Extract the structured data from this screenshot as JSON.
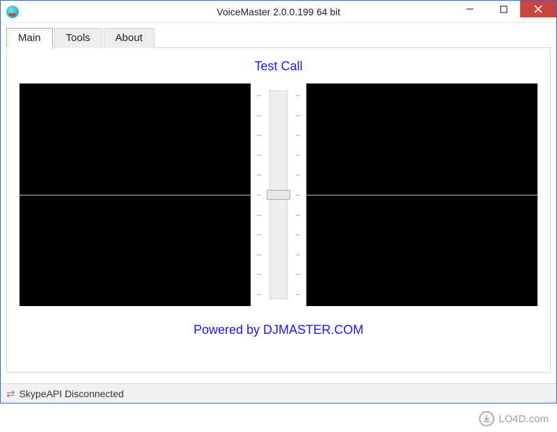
{
  "window": {
    "title": "VoiceMaster 2.0.0.199 64 bit"
  },
  "tabs": [
    {
      "label": "Main",
      "active": true
    },
    {
      "label": "Tools",
      "active": false
    },
    {
      "label": "About",
      "active": false
    }
  ],
  "main": {
    "test_call_label": "Test Call",
    "powered_by": "Powered by DJMASTER.COM",
    "slider_value": 50,
    "slider_min": 0,
    "slider_max": 100
  },
  "statusbar": {
    "text": "SkypeAPI Disconnected"
  },
  "watermark": {
    "text": "LO4D.com"
  }
}
